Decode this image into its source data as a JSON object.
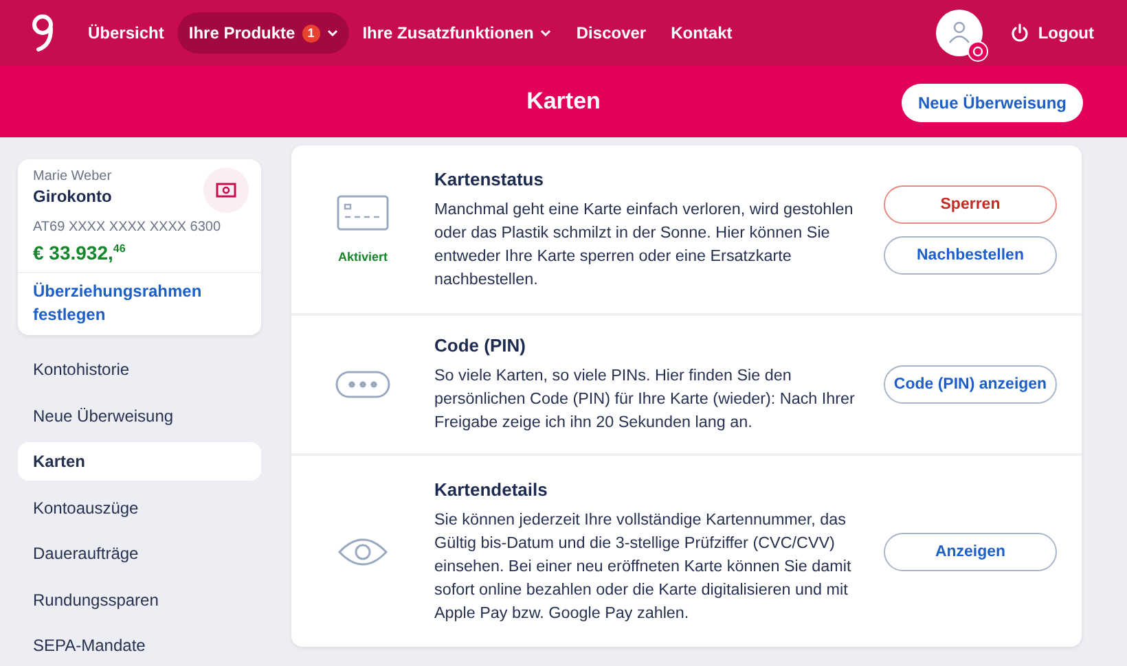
{
  "nav": {
    "items": [
      {
        "label": "Übersicht",
        "selected": false,
        "dropdown": false
      },
      {
        "label": "Ihre Produkte",
        "selected": true,
        "badge": "1",
        "dropdown": true
      },
      {
        "label": "Ihre Zusatzfunktionen",
        "selected": false,
        "dropdown": true
      },
      {
        "label": "Discover",
        "selected": false,
        "dropdown": false
      },
      {
        "label": "Kontakt",
        "selected": false,
        "dropdown": false
      }
    ],
    "logout": "Logout"
  },
  "header": {
    "title": "Karten",
    "action": "Neue Überweisung"
  },
  "account": {
    "owner": "Marie Weber",
    "name": "Girokonto",
    "iban": "AT69 XXXX XXXX XXXX 6300",
    "balance": "€ 33.932,$^{46}$",
    "link": "Überziehungsrahmen festlegen"
  },
  "sidebar": {
    "items": [
      {
        "label": "Kontohistorie",
        "selected": false
      },
      {
        "label": "Neue Überweisung",
        "selected": false
      },
      {
        "label": "Karten",
        "selected": true
      },
      {
        "label": "Kontoauszüge",
        "selected": false
      },
      {
        "label": "Daueraufträge",
        "selected": false
      },
      {
        "label": "Rundungssparen",
        "selected": false
      },
      {
        "label": "SEPA-Mandate",
        "selected": false
      }
    ]
  },
  "sections": [
    {
      "kind": "card",
      "status": "Aktiviert",
      "title": "Kartenstatus",
      "text": "Manchmal geht eine Karte einfach verloren, wird gestohlen oder das Plastik schmilzt in der Sonne. Hier können Sie entweder Ihre Karte sperren oder eine Ersatzkarte nachbestellen.",
      "buttons": [
        {
          "label": "Sperren",
          "kind": "danger"
        },
        {
          "label": "Nachbestellen",
          "kind": "default"
        }
      ]
    },
    {
      "kind": "pin",
      "title": "Code (PIN)",
      "text": "So viele Karten, so viele PINs. Hier finden Sie den persönlichen Code (PIN) für Ihre Karte (wieder): Nach Ihrer Freigabe zeige ich ihn 20 Sekunden lang an.",
      "buttons": [
        {
          "label": "Code (PIN) anzeigen",
          "kind": "default"
        }
      ]
    },
    {
      "kind": "eye",
      "title": "Kartendetails",
      "text": "Sie können jederzeit Ihre vollständige Kartennummer, das Gültig bis-Datum und die 3-stellige Prüfziffer (CVC/CVV) einsehen. Bei einer neu eröffneten Karte können Sie damit sofort online bezahlen oder die Karte digitalisieren und mit Apple Pay bzw. Google Pay zahlen.",
      "buttons": [
        {
          "label": "Anzeigen",
          "kind": "default"
        }
      ]
    }
  ]
}
